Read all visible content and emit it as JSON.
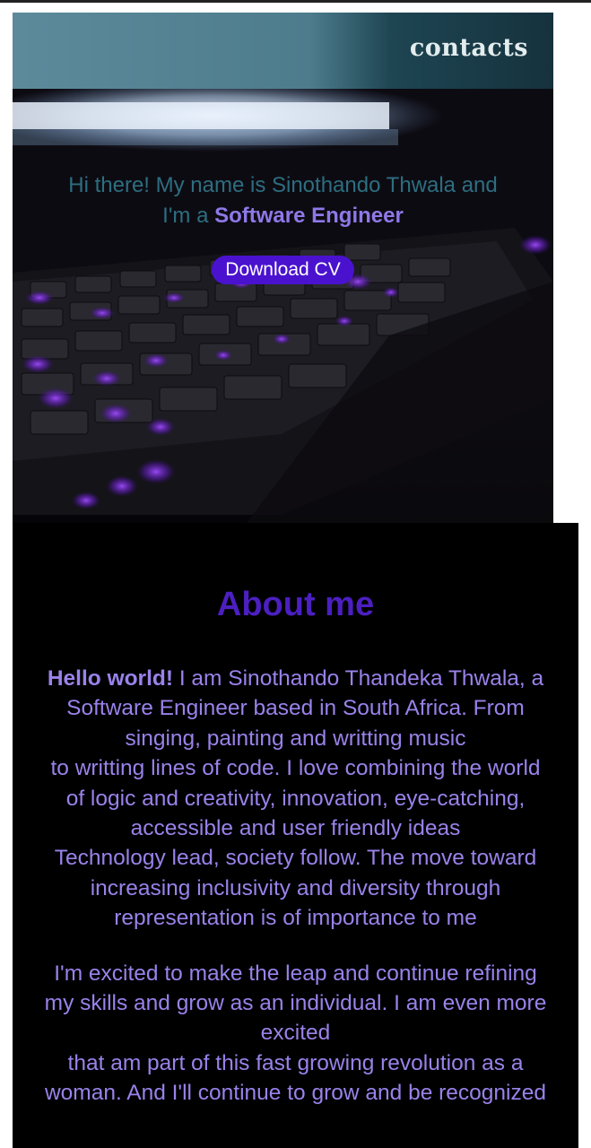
{
  "nav": {
    "contacts_label": "contacts"
  },
  "hero": {
    "greeting": "Hi there! My name is Sinothando Thwala and",
    "role_prefix": "I'm a ",
    "role": "Software Engineer",
    "download_label": "Download CV",
    "background_image": "keyboard-photo"
  },
  "about": {
    "title": "About me",
    "lead": "Hello world!",
    "p1_lines": [
      " I am Sinothando Thandeka Thwala, a",
      "Software Engineer based in South Africa. From",
      "singing, painting and writting music",
      "to writting lines of code. I love combining the world",
      "of logic and creativity, innovation, eye-catching,",
      "accessible and user friendly ideas",
      "Technology lead, society follow. The move toward",
      "increasing inclusivity and diversity through",
      "representation is of importance to me"
    ],
    "p2_lines": [
      "I'm excited to make the leap and continue refining",
      "my skills and grow as an individual. I am even more",
      "excited",
      "that am part of this fast growing revolution as a",
      "woman. And I'll continue to grow and be recognized"
    ]
  },
  "colors": {
    "accent": "#4a12cf",
    "about_title": "#4b1fc0",
    "about_text": "#9a82ea",
    "intro_text": "#2d6e80",
    "navbar": "#4d7c8d"
  }
}
